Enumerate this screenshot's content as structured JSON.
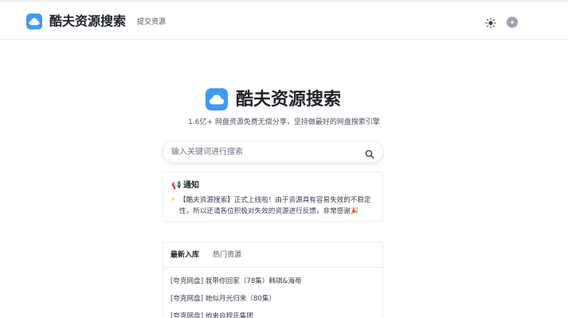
{
  "header": {
    "brand": "酷夫资源搜索",
    "nav_link": "提交资源",
    "theme_icon": "sun-icon",
    "avatar_icon": "avatar"
  },
  "hero": {
    "title": "酷夫资源搜索",
    "subtitle": "1.6亿+ 网盘资源免费无偿分享，坚持做最好的网盘搜索引擎"
  },
  "search": {
    "placeholder": "输入关键词进行搜索",
    "value": "",
    "icon": "search-icon"
  },
  "notice": {
    "title": "通知",
    "body": "【酷夫资源搜索】正式上线啦！由于资源具有容易失效的不稳定性，所以还请各位积极对失效的资源进行反馈，非常感谢",
    "title_icon": "megaphone-icon",
    "body_icon": "bolt-icon",
    "end_icon": "party-hat-icon"
  },
  "list": {
    "tabs": [
      "最新入库",
      "热门资源"
    ],
    "items": [
      "[夸克网盘] 我带你回家（78集）韩琪&海蒂",
      "[夸克网盘] 她似月光归来（80集）",
      "[夸克网盘] 他来自程氏集团"
    ]
  },
  "colors": {
    "accent": "#3d9bf5",
    "text": "#1f2329",
    "border": "#eceef1"
  }
}
